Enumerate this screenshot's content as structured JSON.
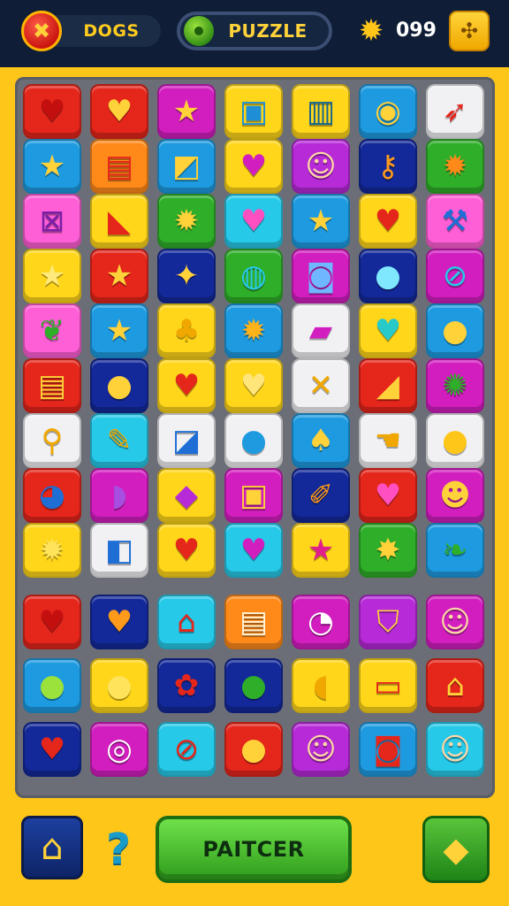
{
  "header": {
    "brand_icon": "x-logo-icon",
    "brand_glyph": "✖",
    "brand_label": "DOGS",
    "mode_icon": "green-ball-icon",
    "mode_label": "PUZZLE",
    "coin_icon": "coin-icon",
    "coin_glyph": "✹",
    "coin_count": "099",
    "settings_icon": "settings-icon",
    "settings_glyph": "✣"
  },
  "colors": {
    "frame": "#ffc61a",
    "board": "#6b6e76",
    "topbar": "#0f1e36",
    "red": "#e5261b",
    "yellow": "#ffd61a",
    "blue": "#1e9be0",
    "navy": "#13299a",
    "purple": "#b72ad8",
    "green": "#2fae2a",
    "cyan": "#27c9e8",
    "pink": "#ff5fd6",
    "magenta": "#d21ebf",
    "orange": "#ff8a1a",
    "white": "#f1f1f4"
  },
  "board": {
    "rows": [
      [
        {
          "bg": "red",
          "icon": "heart-icon",
          "glyph": "♥",
          "fg": "#c40f0f"
        },
        {
          "bg": "red",
          "icon": "heart-icon",
          "glyph": "♥",
          "fg": "#ffd23a"
        },
        {
          "bg": "magenta",
          "icon": "star-icon",
          "glyph": "★",
          "fg": "#ffd23a"
        },
        {
          "bg": "yellow",
          "icon": "camera-icon",
          "glyph": "▣",
          "fg": "#1e8fd6"
        },
        {
          "bg": "yellow",
          "icon": "picture-icon",
          "glyph": "▥",
          "fg": "#15668f"
        },
        {
          "bg": "blue",
          "icon": "clock-icon",
          "glyph": "◉",
          "fg": "#ffd23a"
        },
        {
          "bg": "white",
          "icon": "rocket-icon",
          "glyph": "➶",
          "fg": "#e5261b"
        }
      ],
      [
        {
          "bg": "blue",
          "icon": "star-icon",
          "glyph": "★",
          "fg": "#ffd23a"
        },
        {
          "bg": "orange",
          "icon": "card-icon",
          "glyph": "▤",
          "fg": "#e5261b"
        },
        {
          "bg": "blue",
          "icon": "image-icon",
          "glyph": "◩",
          "fg": "#ffd23a"
        },
        {
          "bg": "yellow",
          "icon": "heart-icon",
          "glyph": "♥",
          "fg": "#d21ebf"
        },
        {
          "bg": "purple",
          "icon": "face-icon",
          "glyph": "☺",
          "fg": "#ffd7a8"
        },
        {
          "bg": "navy",
          "icon": "key-icon",
          "glyph": "⚷",
          "fg": "#ff9a1a"
        },
        {
          "bg": "green",
          "icon": "sun-icon",
          "glyph": "✹",
          "fg": "#ff8a1a"
        }
      ],
      [
        {
          "bg": "pink",
          "icon": "chair-icon",
          "glyph": "⊠",
          "fg": "#7c1fa8"
        },
        {
          "bg": "yellow",
          "icon": "house-icon",
          "glyph": "◣",
          "fg": "#e5261b"
        },
        {
          "bg": "green",
          "icon": "sun-icon",
          "glyph": "✹",
          "fg": "#ffd23a"
        },
        {
          "bg": "cyan",
          "icon": "heart-icon",
          "glyph": "♥",
          "fg": "#ff4fc0"
        },
        {
          "bg": "blue",
          "icon": "star-icon",
          "glyph": "★",
          "fg": "#ffd23a"
        },
        {
          "bg": "yellow",
          "icon": "heart-icon",
          "glyph": "♥",
          "fg": "#e5261b"
        },
        {
          "bg": "pink",
          "icon": "hammer-icon",
          "glyph": "⚒",
          "fg": "#1e6ed6"
        }
      ],
      [
        {
          "bg": "yellow",
          "icon": "star-icon",
          "glyph": "★",
          "fg": "#ffe97a"
        },
        {
          "bg": "red",
          "icon": "star-icon",
          "glyph": "★",
          "fg": "#ffd23a"
        },
        {
          "bg": "navy",
          "icon": "card-star-icon",
          "glyph": "✦",
          "fg": "#ffd23a"
        },
        {
          "bg": "green",
          "icon": "planet-icon",
          "glyph": "◍",
          "fg": "#27c9e8"
        },
        {
          "bg": "magenta",
          "icon": "cup-icon",
          "glyph": "◙",
          "fg": "#6fb7ff"
        },
        {
          "bg": "navy",
          "icon": "orb-icon",
          "glyph": "●",
          "fg": "#7fe8ff"
        },
        {
          "bg": "magenta",
          "icon": "lollipop-icon",
          "glyph": "⊘",
          "fg": "#27c9e8"
        }
      ],
      [
        {
          "bg": "pink",
          "icon": "leaf-icon",
          "glyph": "❦",
          "fg": "#2fae2a"
        },
        {
          "bg": "blue",
          "icon": "star-icon",
          "glyph": "★",
          "fg": "#ffd23a"
        },
        {
          "bg": "yellow",
          "icon": "bell-icon",
          "glyph": "♣",
          "fg": "#f0a800"
        },
        {
          "bg": "blue",
          "icon": "sun-icon",
          "glyph": "✹",
          "fg": "#ffb31a"
        },
        {
          "bg": "white",
          "icon": "box-icon",
          "glyph": "▰",
          "fg": "#d21ebf"
        },
        {
          "bg": "yellow",
          "icon": "heart-icon",
          "glyph": "♥",
          "fg": "#27c9c9"
        },
        {
          "bg": "blue",
          "icon": "bubble-icon",
          "glyph": "●",
          "fg": "#ffd23a"
        }
      ],
      [
        {
          "bg": "red",
          "icon": "window-icon",
          "glyph": "▤",
          "fg": "#ffd23a"
        },
        {
          "bg": "navy",
          "icon": "coin-icon",
          "glyph": "●",
          "fg": "#ffd23a"
        },
        {
          "bg": "yellow",
          "icon": "heart-icon",
          "glyph": "♥",
          "fg": "#e5261b"
        },
        {
          "bg": "yellow",
          "icon": "heart-icon",
          "glyph": "♥",
          "fg": "#ffe57a"
        },
        {
          "bg": "white",
          "icon": "cross-icon",
          "glyph": "✕",
          "fg": "#f0a800"
        },
        {
          "bg": "red",
          "icon": "ramp-icon",
          "glyph": "◢",
          "fg": "#ffd23a"
        },
        {
          "bg": "magenta",
          "icon": "virus-icon",
          "glyph": "✺",
          "fg": "#2fae2a"
        }
      ],
      [
        {
          "bg": "white",
          "icon": "magnifier-icon",
          "glyph": "⚲",
          "fg": "#f0a800"
        },
        {
          "bg": "cyan",
          "icon": "pencil-icon",
          "glyph": "✎",
          "fg": "#f0a800"
        },
        {
          "bg": "white",
          "icon": "cube-icon",
          "glyph": "◪",
          "fg": "#1e6ed6"
        },
        {
          "bg": "white",
          "icon": "fruit-icon",
          "glyph": "●",
          "fg": "#1e9be0"
        },
        {
          "bg": "blue",
          "icon": "acorn-icon",
          "glyph": "♠",
          "fg": "#ffd23a"
        },
        {
          "bg": "white",
          "icon": "hand-icon",
          "glyph": "☚",
          "fg": "#f0a800"
        },
        {
          "bg": "white",
          "icon": "lemon-icon",
          "glyph": "●",
          "fg": "#ffc61a"
        }
      ],
      [
        {
          "bg": "red",
          "icon": "fish-icon",
          "glyph": "◕",
          "fg": "#1e6ed6"
        },
        {
          "bg": "magenta",
          "icon": "shell-icon",
          "glyph": "◗",
          "fg": "#a64fe0"
        },
        {
          "bg": "yellow",
          "icon": "feather-icon",
          "glyph": "◆",
          "fg": "#b72ad8"
        },
        {
          "bg": "magenta",
          "icon": "frame-icon",
          "glyph": "▣",
          "fg": "#ffd23a"
        },
        {
          "bg": "navy",
          "icon": "brush-icon",
          "glyph": "✐",
          "fg": "#ff9a1a"
        },
        {
          "bg": "red",
          "icon": "heart-icon",
          "glyph": "♥",
          "fg": "#ff4fc0"
        },
        {
          "bg": "magenta",
          "icon": "surprised-face-icon",
          "glyph": "☻",
          "fg": "#ffd23a"
        }
      ],
      [
        {
          "bg": "yellow",
          "icon": "sun-icon",
          "glyph": "✹",
          "fg": "#ffe35a"
        },
        {
          "bg": "white",
          "icon": "square-icon",
          "glyph": "◧",
          "fg": "#1e6ed6"
        },
        {
          "bg": "yellow",
          "icon": "apple-icon",
          "glyph": "♥",
          "fg": "#e5261b"
        },
        {
          "bg": "cyan",
          "icon": "heart-icon",
          "glyph": "♥",
          "fg": "#d21ebf"
        },
        {
          "bg": "yellow",
          "icon": "star-icon",
          "glyph": "★",
          "fg": "#e01e8c"
        },
        {
          "bg": "green",
          "icon": "lamp-icon",
          "glyph": "✸",
          "fg": "#ffd23a"
        },
        {
          "bg": "blue",
          "icon": "leaf-icon",
          "glyph": "❧",
          "fg": "#2fae2a"
        }
      ],
      [
        {
          "bg": "red",
          "icon": "apple-icon",
          "glyph": "♥",
          "fg": "#c40f0f"
        },
        {
          "bg": "navy",
          "icon": "heart-icon",
          "glyph": "♥",
          "fg": "#ff9a1a"
        },
        {
          "bg": "cyan",
          "icon": "house-icon",
          "glyph": "⌂",
          "fg": "#e5261b"
        },
        {
          "bg": "orange",
          "icon": "notepad-icon",
          "glyph": "▤",
          "fg": "#fff4d6"
        },
        {
          "bg": "magenta",
          "icon": "ball-icon",
          "glyph": "◔",
          "fg": "#ffffff"
        },
        {
          "bg": "purple",
          "icon": "shield-icon",
          "glyph": "⛉",
          "fg": "#ffd23a"
        },
        {
          "bg": "magenta",
          "icon": "boy-face-icon",
          "glyph": "☺",
          "fg": "#ffd7a8"
        }
      ],
      [
        {
          "bg": "blue",
          "icon": "lime-icon",
          "glyph": "●",
          "fg": "#9be23c"
        },
        {
          "bg": "yellow",
          "icon": "lemon-icon",
          "glyph": "●",
          "fg": "#ffe35a"
        },
        {
          "bg": "navy",
          "icon": "flower-icon",
          "glyph": "✿",
          "fg": "#e5261b"
        },
        {
          "bg": "navy",
          "icon": "olive-icon",
          "glyph": "●",
          "fg": "#2fae2a"
        },
        {
          "bg": "yellow",
          "icon": "leaf-icon",
          "glyph": "◖",
          "fg": "#f0a800"
        },
        {
          "bg": "yellow",
          "icon": "basket-icon",
          "glyph": "▭",
          "fg": "#e5261b"
        },
        {
          "bg": "red",
          "icon": "house-icon",
          "glyph": "⌂",
          "fg": "#ffd23a"
        }
      ],
      [
        {
          "bg": "navy",
          "icon": "heart-icon",
          "glyph": "♥",
          "fg": "#e5261b"
        },
        {
          "bg": "magenta",
          "icon": "mouth-icon",
          "glyph": "◎",
          "fg": "#ffffff"
        },
        {
          "bg": "cyan",
          "icon": "no-sign-icon",
          "glyph": "⊘",
          "fg": "#e5261b"
        },
        {
          "bg": "red",
          "icon": "apple-icon",
          "glyph": "●",
          "fg": "#ffd23a"
        },
        {
          "bg": "purple",
          "icon": "girl-face-icon",
          "glyph": "☺",
          "fg": "#ffd7a8"
        },
        {
          "bg": "blue",
          "icon": "bear-icon",
          "glyph": "◙",
          "fg": "#e5261b"
        },
        {
          "bg": "cyan",
          "icon": "elf-face-icon",
          "glyph": "☺",
          "fg": "#ffd7a8"
        }
      ]
    ]
  },
  "footer": {
    "home_icon": "home-icon",
    "home_glyph": "⌂",
    "help_icon": "question-icon",
    "help_glyph": "?",
    "action_label": "PAITCER",
    "gold_icon": "gold-bar-icon",
    "gold_glyph": "◆"
  }
}
